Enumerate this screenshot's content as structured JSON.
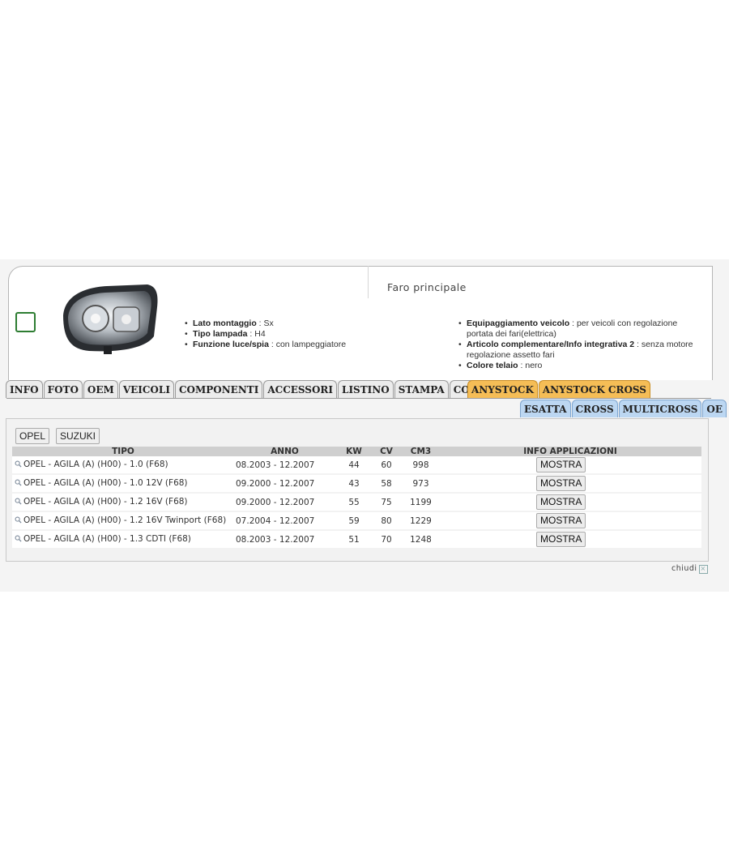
{
  "product": {
    "title": "Faro principale",
    "attributes_left": [
      {
        "name": "Lato montaggio",
        "value": "Sx"
      },
      {
        "name": "Tipo lampada",
        "value": "H4"
      },
      {
        "name": "Funzione luce/spia",
        "value": "con lampeggiatore"
      }
    ],
    "attributes_right": [
      {
        "name": "Equipaggiamento veicolo",
        "value": "per veicoli con regolazione portata dei fari(elettrica)"
      },
      {
        "name": "Articolo complementare/Info integrativa 2",
        "value": "senza motore regolazione assetto fari"
      },
      {
        "name": "Colore telaio",
        "value": "nero"
      }
    ]
  },
  "tabs_main": [
    "INFO",
    "FOTO",
    "OEM",
    "VEICOLI",
    "COMPONENTI",
    "ACCESSORI",
    "LISTINO",
    "STAMPA",
    "COMPRA"
  ],
  "tabs_anystock": [
    "ANYSTOCK",
    "ANYSTOCK CROSS"
  ],
  "tabs_sub": [
    "ESATTA",
    "CROSS",
    "MULTICROSS",
    "OE"
  ],
  "brands": [
    "OPEL",
    "SUZUKI"
  ],
  "table": {
    "headers": [
      "TIPO",
      "ANNO",
      "KW",
      "CV",
      "CM3",
      "INFO APPLICAZIONI"
    ],
    "rows": [
      {
        "tipo": "OPEL - AGILA (A) (H00) - 1.0 (F68)",
        "anno": "08.2003 - 12.2007",
        "kw": "44",
        "cv": "60",
        "cm3": "998",
        "action": "MOSTRA"
      },
      {
        "tipo": "OPEL - AGILA (A) (H00) - 1.0 12V (F68)",
        "anno": "09.2000 - 12.2007",
        "kw": "43",
        "cv": "58",
        "cm3": "973",
        "action": "MOSTRA"
      },
      {
        "tipo": "OPEL - AGILA (A) (H00) - 1.2 16V (F68)",
        "anno": "09.2000 - 12.2007",
        "kw": "55",
        "cv": "75",
        "cm3": "1199",
        "action": "MOSTRA"
      },
      {
        "tipo": "OPEL - AGILA (A) (H00) - 1.2 16V Twinport (F68)",
        "anno": "07.2004 - 12.2007",
        "kw": "59",
        "cv": "80",
        "cm3": "1229",
        "action": "MOSTRA"
      },
      {
        "tipo": "OPEL - AGILA (A) (H00) - 1.3 CDTI (F68)",
        "anno": "08.2003 - 12.2007",
        "kw": "51",
        "cv": "70",
        "cm3": "1248",
        "action": "MOSTRA"
      }
    ]
  },
  "footer": {
    "close_label": "chiudi"
  }
}
